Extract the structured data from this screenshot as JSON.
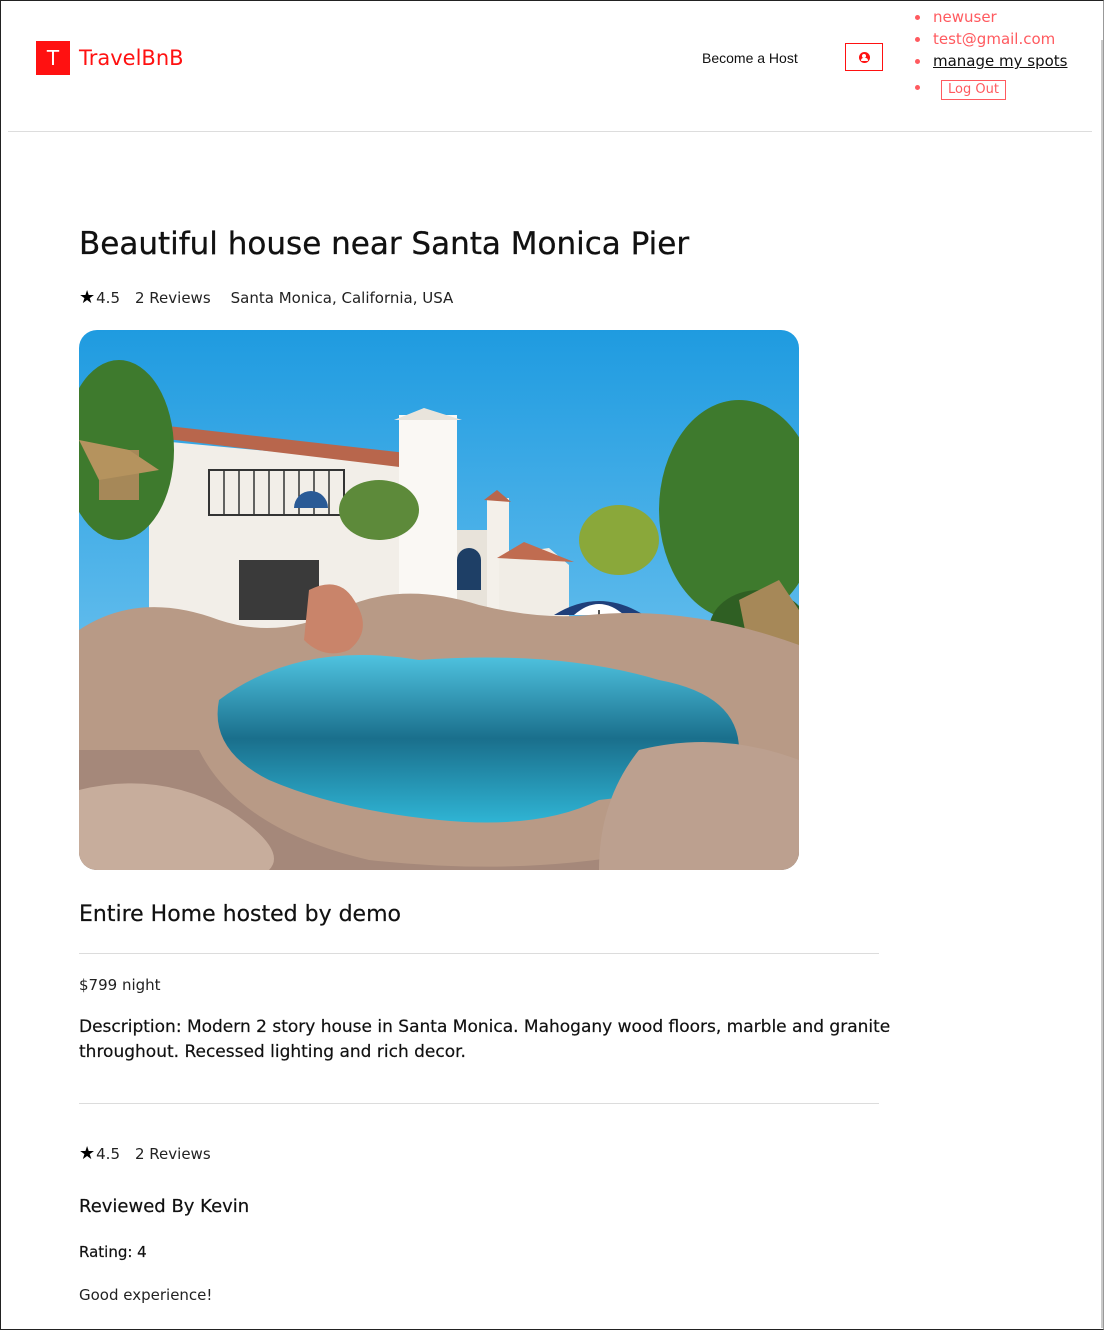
{
  "header": {
    "logo_letter": "T",
    "logo_text": "TravelBnB",
    "become_host": "Become a Host",
    "profile_icon": "user-circle-icon",
    "menu": {
      "username": "newuser",
      "email": "test@gmail.com",
      "manage_spots": "manage my spots",
      "logout": "Log Out"
    }
  },
  "spot": {
    "title": "Beautiful house near Santa Monica Pier",
    "rating": "4.5",
    "reviews_count": "2 Reviews",
    "location": "Santa Monica, California, USA",
    "image_alt": "Pool and house photo",
    "host_line": "Entire Home hosted by demo",
    "price": "$799 night",
    "description": "Description: Modern 2 story house in Santa Monica. Mahogany wood floors, marble and granite throughout. Recessed lighting and rich decor."
  },
  "reviews_section": {
    "rating": "4.5",
    "reviews_count": "2 Reviews",
    "items": [
      {
        "reviewer": "Reviewed By Kevin",
        "rating": "Rating: 4",
        "comment": "Good experience!"
      }
    ]
  },
  "colors": {
    "brand": "#ff1111",
    "menu_accent": "#ff5a5f"
  }
}
